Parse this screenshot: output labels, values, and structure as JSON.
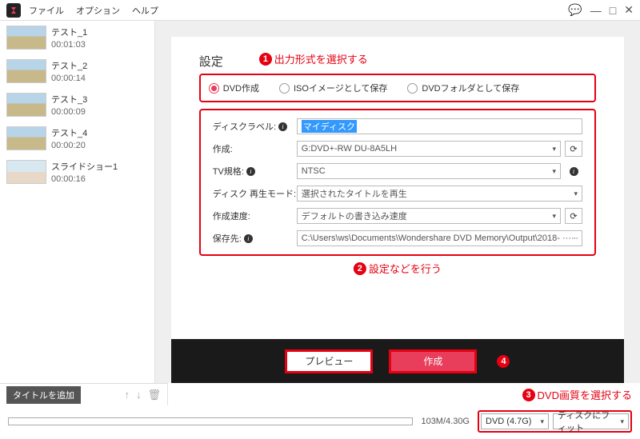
{
  "menu": {
    "file": "ファイル",
    "options": "オプション",
    "help": "ヘルプ"
  },
  "sidebar": {
    "items": [
      {
        "name": "テスト_1",
        "time": "00:01:03"
      },
      {
        "name": "テスト_2",
        "time": "00:00:14"
      },
      {
        "name": "テスト_3",
        "time": "00:00:09"
      },
      {
        "name": "テスト_4",
        "time": "00:00:20"
      },
      {
        "name": "スライドショー1",
        "time": "00:00:16"
      }
    ],
    "add_title": "タイトルを追加"
  },
  "panel": {
    "title": "設定",
    "ann1": "出力形式を選択する",
    "ann2": "設定などを行う",
    "ann3": "DVD画質を選択する",
    "radios": {
      "r1": "DVD作成",
      "r2": "ISOイメージとして保存",
      "r3": "DVDフォルダとして保存"
    },
    "labels": {
      "disc_label": "ディスクラベル:",
      "create": "作成:",
      "tv": "TV規格:",
      "playmode": "ディスク 再生モード:",
      "speed": "作成速度:",
      "saveto": "保存先:"
    },
    "values": {
      "disc_label": "マイディスク",
      "create": "G:DVD+-RW DU-8A5LH",
      "tv": "NTSC",
      "playmode": "選択されたタイトルを再生",
      "speed": "デフォルトの書き込み速度",
      "saveto": "C:\\Users\\ws\\Documents\\Wondershare DVD Memory\\Output\\2018- ···"
    }
  },
  "buttons": {
    "preview": "プレビュー",
    "create": "作成"
  },
  "status": {
    "size": "103M/4.30G",
    "disc_type": "DVD (4.7G)",
    "quality": "ディスクにフィット"
  }
}
